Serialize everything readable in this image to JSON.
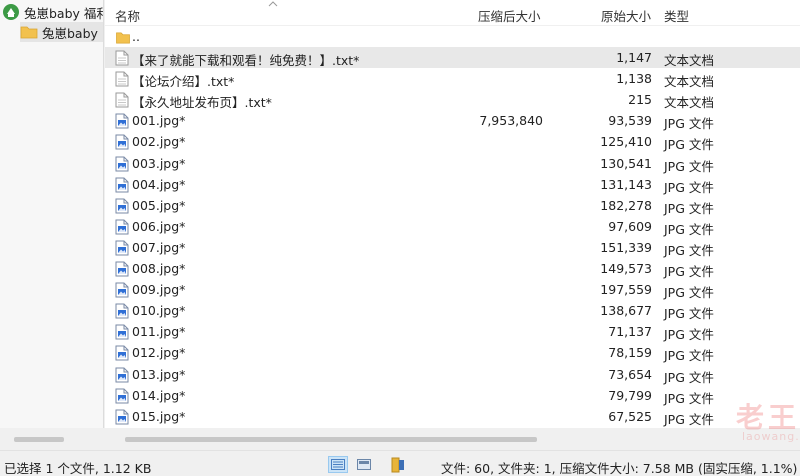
{
  "tree": {
    "root_label": "兔崽baby 福利",
    "child_label": "兔崽baby"
  },
  "columns": {
    "name": "名称",
    "packed": "压缩后大小",
    "size": "原始大小",
    "type": "类型"
  },
  "parent_dir_label": "..",
  "files": [
    {
      "name": "【来了就能下载和观看！纯免费！】.txt*",
      "packed": "",
      "size": "1,147",
      "type": "文本文档",
      "kind": "txt",
      "selected": true
    },
    {
      "name": "【论坛介绍】.txt*",
      "packed": "",
      "size": "1,138",
      "type": "文本文档",
      "kind": "txt"
    },
    {
      "name": "【永久地址发布页】.txt*",
      "packed": "",
      "size": "215",
      "type": "文本文档",
      "kind": "txt"
    },
    {
      "name": "001.jpg*",
      "packed": "7,953,840",
      "size": "93,539",
      "type": "JPG 文件",
      "kind": "jpg"
    },
    {
      "name": "002.jpg*",
      "packed": "",
      "size": "125,410",
      "type": "JPG 文件",
      "kind": "jpg"
    },
    {
      "name": "003.jpg*",
      "packed": "",
      "size": "130,541",
      "type": "JPG 文件",
      "kind": "jpg"
    },
    {
      "name": "004.jpg*",
      "packed": "",
      "size": "131,143",
      "type": "JPG 文件",
      "kind": "jpg"
    },
    {
      "name": "005.jpg*",
      "packed": "",
      "size": "182,278",
      "type": "JPG 文件",
      "kind": "jpg"
    },
    {
      "name": "006.jpg*",
      "packed": "",
      "size": "97,609",
      "type": "JPG 文件",
      "kind": "jpg"
    },
    {
      "name": "007.jpg*",
      "packed": "",
      "size": "151,339",
      "type": "JPG 文件",
      "kind": "jpg"
    },
    {
      "name": "008.jpg*",
      "packed": "",
      "size": "149,573",
      "type": "JPG 文件",
      "kind": "jpg"
    },
    {
      "name": "009.jpg*",
      "packed": "",
      "size": "197,559",
      "type": "JPG 文件",
      "kind": "jpg"
    },
    {
      "name": "010.jpg*",
      "packed": "",
      "size": "138,677",
      "type": "JPG 文件",
      "kind": "jpg"
    },
    {
      "name": "011.jpg*",
      "packed": "",
      "size": "71,137",
      "type": "JPG 文件",
      "kind": "jpg"
    },
    {
      "name": "012.jpg*",
      "packed": "",
      "size": "78,159",
      "type": "JPG 文件",
      "kind": "jpg"
    },
    {
      "name": "013.jpg*",
      "packed": "",
      "size": "73,654",
      "type": "JPG 文件",
      "kind": "jpg"
    },
    {
      "name": "014.jpg*",
      "packed": "",
      "size": "79,799",
      "type": "JPG 文件",
      "kind": "jpg"
    },
    {
      "name": "015.jpg*",
      "packed": "",
      "size": "67,525",
      "type": "JPG 文件",
      "kind": "jpg"
    }
  ],
  "status": {
    "selection": "已选择 1 个文件, 1.12 KB",
    "summary": "文件: 60, 文件夹: 1, 压缩文件大小: 7.58 MB (固实压缩, 1.1%)"
  },
  "watermark": {
    "line1": "老王论坛",
    "line2": "laowang.vip"
  },
  "colors": {
    "selected_row": "#e8e8e8",
    "folder": "#f2c14e",
    "jpg_icon_blue": "#2f6fd6",
    "watermark": "#e85050"
  },
  "icons": {
    "archive": "archive-icon",
    "folder": "folder-icon",
    "text_file": "text-file-icon",
    "image_file": "image-file-icon"
  }
}
